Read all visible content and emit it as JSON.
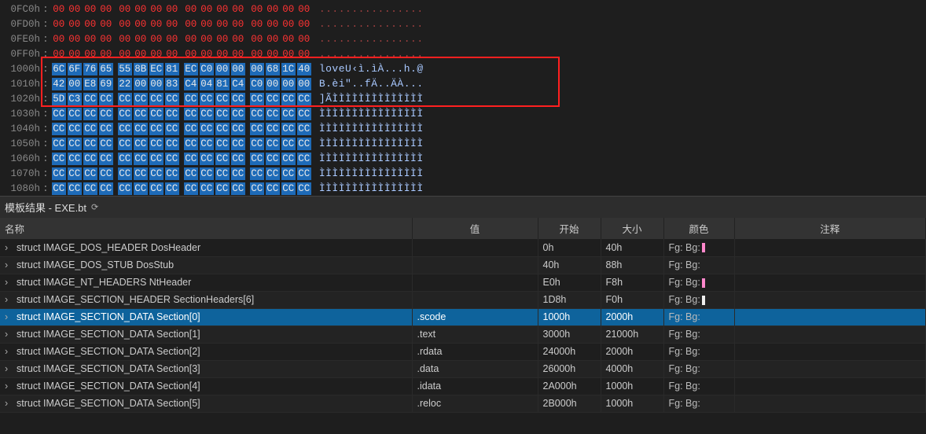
{
  "hex": {
    "rows": [
      {
        "addr": "0FC0h",
        "bytes": [
          "00",
          "00",
          "00",
          "00",
          "00",
          "00",
          "00",
          "00",
          "00",
          "00",
          "00",
          "00",
          "00",
          "00",
          "00",
          "00"
        ],
        "ascii": "................",
        "style": "red"
      },
      {
        "addr": "0FD0h",
        "bytes": [
          "00",
          "00",
          "00",
          "00",
          "00",
          "00",
          "00",
          "00",
          "00",
          "00",
          "00",
          "00",
          "00",
          "00",
          "00",
          "00"
        ],
        "ascii": "................",
        "style": "red"
      },
      {
        "addr": "0FE0h",
        "bytes": [
          "00",
          "00",
          "00",
          "00",
          "00",
          "00",
          "00",
          "00",
          "00",
          "00",
          "00",
          "00",
          "00",
          "00",
          "00",
          "00"
        ],
        "ascii": "................",
        "style": "red"
      },
      {
        "addr": "0FF0h",
        "bytes": [
          "00",
          "00",
          "00",
          "00",
          "00",
          "00",
          "00",
          "00",
          "00",
          "00",
          "00",
          "00",
          "00",
          "00",
          "00",
          "00"
        ],
        "ascii": "................",
        "style": "red"
      },
      {
        "addr": "1000h",
        "bytes": [
          "6C",
          "6F",
          "76",
          "65",
          "55",
          "8B",
          "EC",
          "81",
          "EC",
          "C0",
          "00",
          "00",
          "00",
          "68",
          "1C",
          "40"
        ],
        "ascii": "loveU‹ì.ìÀ...h.@",
        "style": "blue"
      },
      {
        "addr": "1010h",
        "bytes": [
          "42",
          "00",
          "E8",
          "69",
          "22",
          "00",
          "00",
          "83",
          "C4",
          "04",
          "81",
          "C4",
          "C0",
          "00",
          "00",
          "00"
        ],
        "ascii": "B.èi\"..fÄ..ÄÀ...",
        "style": "blue"
      },
      {
        "addr": "1020h",
        "bytes": [
          "5D",
          "C3",
          "CC",
          "CC",
          "CC",
          "CC",
          "CC",
          "CC",
          "CC",
          "CC",
          "CC",
          "CC",
          "CC",
          "CC",
          "CC",
          "CC"
        ],
        "ascii": "]ÃÌÌÌÌÌÌÌÌÌÌÌÌÌÌ",
        "style": "blue"
      },
      {
        "addr": "1030h",
        "bytes": [
          "CC",
          "CC",
          "CC",
          "CC",
          "CC",
          "CC",
          "CC",
          "CC",
          "CC",
          "CC",
          "CC",
          "CC",
          "CC",
          "CC",
          "CC",
          "CC"
        ],
        "ascii": "ÌÌÌÌÌÌÌÌÌÌÌÌÌÌÌÌ",
        "style": "blue"
      },
      {
        "addr": "1040h",
        "bytes": [
          "CC",
          "CC",
          "CC",
          "CC",
          "CC",
          "CC",
          "CC",
          "CC",
          "CC",
          "CC",
          "CC",
          "CC",
          "CC",
          "CC",
          "CC",
          "CC"
        ],
        "ascii": "ÌÌÌÌÌÌÌÌÌÌÌÌÌÌÌÌ",
        "style": "blue"
      },
      {
        "addr": "1050h",
        "bytes": [
          "CC",
          "CC",
          "CC",
          "CC",
          "CC",
          "CC",
          "CC",
          "CC",
          "CC",
          "CC",
          "CC",
          "CC",
          "CC",
          "CC",
          "CC",
          "CC"
        ],
        "ascii": "ÌÌÌÌÌÌÌÌÌÌÌÌÌÌÌÌ",
        "style": "blue"
      },
      {
        "addr": "1060h",
        "bytes": [
          "CC",
          "CC",
          "CC",
          "CC",
          "CC",
          "CC",
          "CC",
          "CC",
          "CC",
          "CC",
          "CC",
          "CC",
          "CC",
          "CC",
          "CC",
          "CC"
        ],
        "ascii": "ÌÌÌÌÌÌÌÌÌÌÌÌÌÌÌÌ",
        "style": "blue"
      },
      {
        "addr": "1070h",
        "bytes": [
          "CC",
          "CC",
          "CC",
          "CC",
          "CC",
          "CC",
          "CC",
          "CC",
          "CC",
          "CC",
          "CC",
          "CC",
          "CC",
          "CC",
          "CC",
          "CC"
        ],
        "ascii": "ÌÌÌÌÌÌÌÌÌÌÌÌÌÌÌÌ",
        "style": "blue"
      },
      {
        "addr": "1080h",
        "bytes": [
          "CC",
          "CC",
          "CC",
          "CC",
          "CC",
          "CC",
          "CC",
          "CC",
          "CC",
          "CC",
          "CC",
          "CC",
          "CC",
          "CC",
          "CC",
          "CC"
        ],
        "ascii": "ÌÌÌÌÌÌÌÌÌÌÌÌÌÌÌÌ",
        "style": "blue"
      }
    ]
  },
  "panel": {
    "title": "模板结果 - EXE.bt"
  },
  "table": {
    "headers": {
      "name": "名称",
      "value": "值",
      "start": "开始",
      "size": "大小",
      "color": "颜色",
      "comment": "注释"
    },
    "fg_label": "Fg:",
    "bg_label": "Bg:",
    "rows": [
      {
        "name": "struct IMAGE_DOS_HEADER DosHeader",
        "value": "",
        "start": "0h",
        "size": "40h",
        "swatch": "pink",
        "selected": false
      },
      {
        "name": "struct IMAGE_DOS_STUB DosStub",
        "value": "",
        "start": "40h",
        "size": "88h",
        "swatch": "",
        "selected": false
      },
      {
        "name": "struct IMAGE_NT_HEADERS NtHeader",
        "value": "",
        "start": "E0h",
        "size": "F8h",
        "swatch": "pink",
        "selected": false
      },
      {
        "name": "struct IMAGE_SECTION_HEADER SectionHeaders[6]",
        "value": "",
        "start": "1D8h",
        "size": "F0h",
        "swatch": "white",
        "selected": false
      },
      {
        "name": "struct IMAGE_SECTION_DATA Section[0]",
        "value": ".scode",
        "start": "1000h",
        "size": "2000h",
        "swatch": "",
        "selected": true
      },
      {
        "name": "struct IMAGE_SECTION_DATA Section[1]",
        "value": ".text",
        "start": "3000h",
        "size": "21000h",
        "swatch": "",
        "selected": false
      },
      {
        "name": "struct IMAGE_SECTION_DATA Section[2]",
        "value": ".rdata",
        "start": "24000h",
        "size": "2000h",
        "swatch": "",
        "selected": false
      },
      {
        "name": "struct IMAGE_SECTION_DATA Section[3]",
        "value": ".data",
        "start": "26000h",
        "size": "4000h",
        "swatch": "",
        "selected": false
      },
      {
        "name": "struct IMAGE_SECTION_DATA Section[4]",
        "value": ".idata",
        "start": "2A000h",
        "size": "1000h",
        "swatch": "",
        "selected": false
      },
      {
        "name": "struct IMAGE_SECTION_DATA Section[5]",
        "value": ".reloc",
        "start": "2B000h",
        "size": "1000h",
        "swatch": "",
        "selected": false
      }
    ]
  }
}
